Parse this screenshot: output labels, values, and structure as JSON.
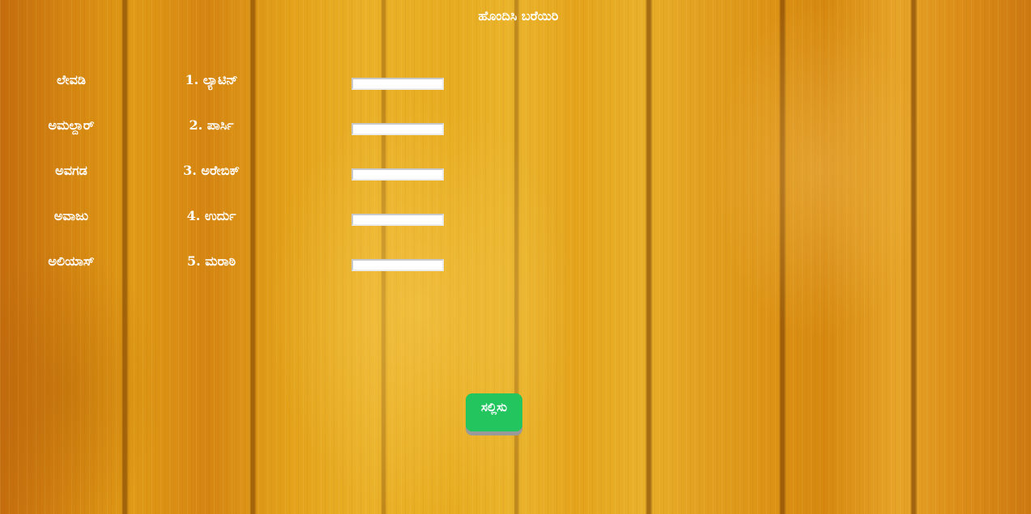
{
  "title": "ಹೊಂದಿಸಿ ಬರೆಯಿರಿ",
  "rows": [
    {
      "word": "ಲೇವಡಿ",
      "language": "1. ಲ್ಯಾಟಿನ್",
      "answer": ""
    },
    {
      "word": "ಅಮಲ್ದಾರ್",
      "language": "2. ಪಾರ್ಸಿ",
      "answer": ""
    },
    {
      "word": "ಅವಗಡ",
      "language": "3. ಅರೇಬಿಕ್",
      "answer": ""
    },
    {
      "word": "ಅವಾಜು",
      "language": "4. ಉರ್ದು",
      "answer": ""
    },
    {
      "word": "ಅಲಿಯಾಸ್",
      "language": "5. ಮರಾಠಿ",
      "answer": ""
    }
  ],
  "submit_label": "ಸಲ್ಲಿಸು",
  "colors": {
    "submit_button": "#22c55e",
    "text": "#ffffff",
    "wood": "#e3a21a"
  }
}
